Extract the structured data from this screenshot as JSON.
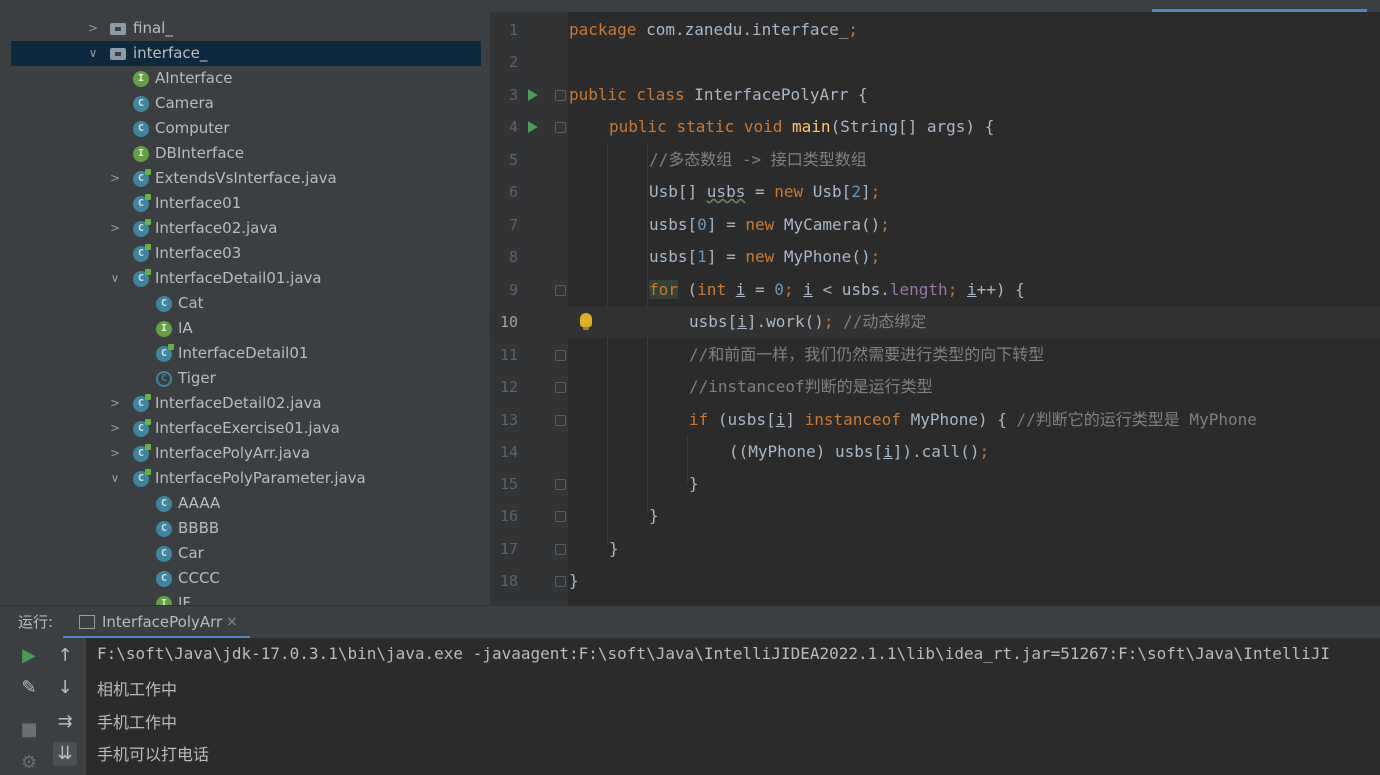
{
  "project_tree": {
    "rows": [
      {
        "label": "final_",
        "icon": "folder-icon"
      },
      {
        "label": "interface_",
        "icon": "folder-icon"
      },
      {
        "label": "AInterface",
        "icon": "interface-icon"
      },
      {
        "label": "Camera",
        "icon": "class-icon"
      },
      {
        "label": "Computer",
        "icon": "class-icon"
      },
      {
        "label": "DBInterface",
        "icon": "interface-icon"
      },
      {
        "label": "ExtendsVsInterface.java",
        "icon": "java-file-icon"
      },
      {
        "label": "Interface01",
        "icon": "class-icon"
      },
      {
        "label": "Interface02.java",
        "icon": "java-file-icon"
      },
      {
        "label": "Interface03",
        "icon": "class-icon"
      },
      {
        "label": "InterfaceDetail01.java",
        "icon": "java-file-icon"
      },
      {
        "label": "Cat",
        "icon": "class-icon"
      },
      {
        "label": "IA",
        "icon": "interface-icon"
      },
      {
        "label": "InterfaceDetail01",
        "icon": "class-icon"
      },
      {
        "label": "Tiger",
        "icon": "abstract-class-icon"
      },
      {
        "label": "InterfaceDetail02.java",
        "icon": "java-file-icon"
      },
      {
        "label": "InterfaceExercise01.java",
        "icon": "java-file-icon"
      },
      {
        "label": "InterfacePolyArr.java",
        "icon": "java-file-icon"
      },
      {
        "label": "InterfacePolyParameter.java",
        "icon": "java-file-icon"
      },
      {
        "label": "AAAA",
        "icon": "class-icon"
      },
      {
        "label": "BBBB",
        "icon": "class-icon"
      },
      {
        "label": "Car",
        "icon": "class-icon"
      },
      {
        "label": "CCCC",
        "icon": "class-icon"
      },
      {
        "label": "IF",
        "icon": "interface-icon"
      }
    ]
  },
  "editor": {
    "line_numbers": [
      "1",
      "2",
      "3",
      "4",
      "5",
      "6",
      "7",
      "8",
      "9",
      "10",
      "11",
      "12",
      "13",
      "14",
      "15",
      "16",
      "17",
      "18"
    ],
    "current_line": "10",
    "code": {
      "l1_pkg": "package",
      "l1_name": " com.zanedu.interface_",
      "l1_semi": ";",
      "l3_kw": "public class",
      "l3_rest": " InterfacePolyArr {",
      "l4_kw": "public static void",
      "l4_fn": "main",
      "l4_rest": "(String[] args) {",
      "l5_cm": "//多态数组 -> 接口类型数组",
      "l6_a": "Usb[] ",
      "l6_var": "usbs",
      "l6_b": " = ",
      "l6_new": "new",
      "l6_c": " Usb[",
      "l6_num": "2",
      "l6_d": "]",
      "l6_semi": ";",
      "l7_a": "usbs[",
      "l7_num": "0",
      "l7_b": "] = ",
      "l7_new": "new",
      "l7_c": " MyCamera()",
      "l7_semi": ";",
      "l8_a": "usbs[",
      "l8_num": "1",
      "l8_b": "] = ",
      "l8_new": "new",
      "l8_c": " MyPhone()",
      "l8_semi": ";",
      "l9_for": "for",
      "l9_a": " (",
      "l9_int": "int",
      "l9_i1": "i",
      "l9_b": " = ",
      "l9_num": "0",
      "l9_semi1": ";",
      "l9_i2": "i",
      "l9_c": " < usbs.",
      "l9_len": "length",
      "l9_semi2": ";",
      "l9_i3": "i",
      "l9_d": "++) {",
      "l10_a": "usbs[",
      "l10_i": "i",
      "l10_b": "].work()",
      "l10_semi": ";",
      "l10_cm": " //动态绑定",
      "l11_cm": "//和前面一样，我们仍然需要进行类型的向下转型",
      "l12_cm": "//instanceof判断的是运行类型",
      "l13_if": "if",
      "l13_a": " (usbs[",
      "l13_i": "i",
      "l13_b": "] ",
      "l13_inst": "instanceof",
      "l13_c": " MyPhone) { ",
      "l13_cm": "//判断它的运行类型是 MyPhone",
      "l14_a": "((MyPhone) usbs[",
      "l14_i": "i",
      "l14_b": "]).call()",
      "l14_semi": ";",
      "l15": "}",
      "l16": "}",
      "l17": "}",
      "l18": "}"
    }
  },
  "run_panel": {
    "label": "运行:",
    "tab_label": "InterfacePolyArr",
    "tab_close": "×",
    "output": [
      "F:\\soft\\Java\\jdk-17.0.3.1\\bin\\java.exe -javaagent:F:\\soft\\Java\\IntelliJIDEA2022.1.1\\lib\\idea_rt.jar=51267:F:\\soft\\Java\\IntelliJI",
      "相机工作中",
      "手机工作中",
      "手机可以打电话"
    ]
  },
  "colors": {
    "keyword": "#cc7832",
    "function": "#ffc66d",
    "number": "#6897bb",
    "comment": "#808080",
    "field": "#9876aa",
    "selection": "#0d293e",
    "accent": "#4a88c7"
  }
}
